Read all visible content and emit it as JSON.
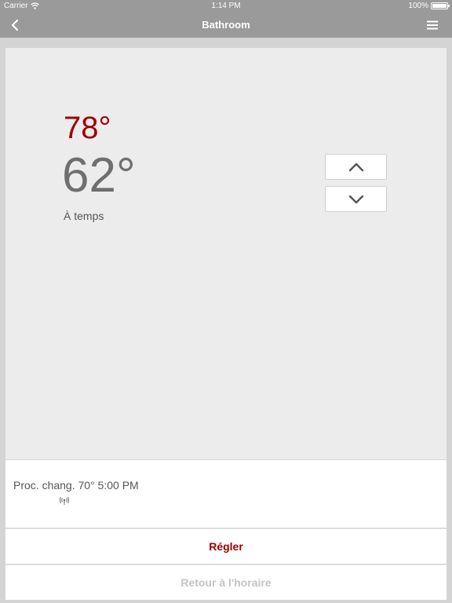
{
  "status_bar": {
    "carrier": "Carrier",
    "time": "1:14 PM",
    "battery": "100%"
  },
  "nav": {
    "title": "Bathroom",
    "back_icon": "chevron-left-icon",
    "menu_icon": "hamburger-menu-icon"
  },
  "thermostat": {
    "setpoint": "78°",
    "current": "62°",
    "status": "À temps"
  },
  "info": {
    "next_change": "Proc. chang. 70° 5:00 PM",
    "signal_icon": "wireless-signal-icon"
  },
  "actions": {
    "adjust_label": "Régler",
    "resume_label": "Retour à l'horaire"
  },
  "colors": {
    "bar": "#9a9a9a",
    "accent": "#a00000",
    "disabled": "#c4c4c4"
  }
}
